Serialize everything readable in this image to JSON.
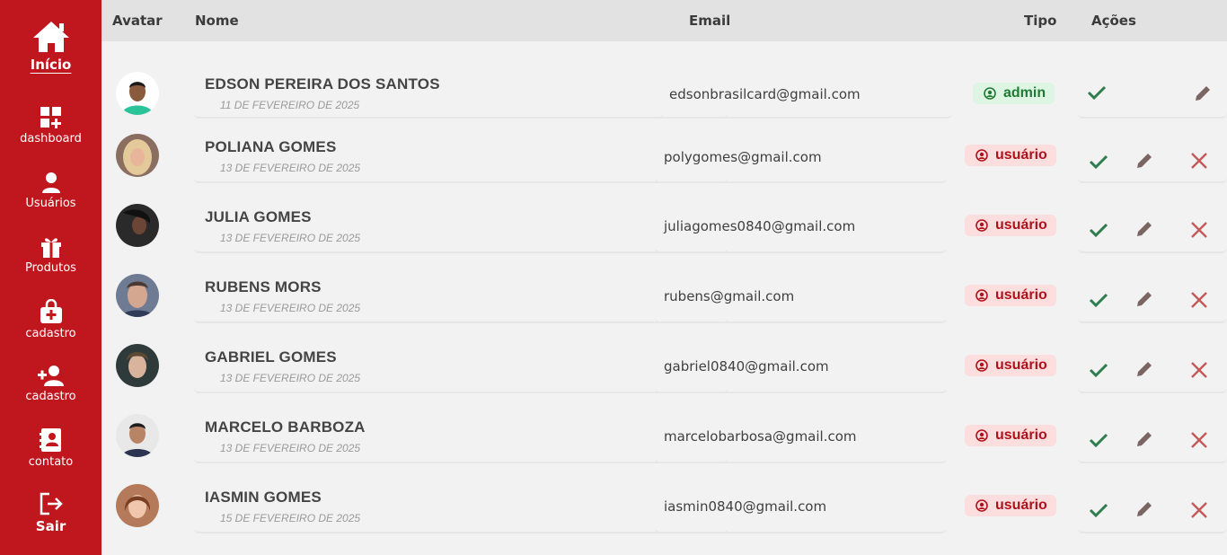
{
  "sidebar": {
    "items": [
      {
        "label": "Início",
        "icon": "home-icon"
      },
      {
        "label": "dashboard",
        "icon": "dashboard-icon"
      },
      {
        "label": "Usuários",
        "icon": "user-icon"
      },
      {
        "label": "Produtos",
        "icon": "gift-icon"
      },
      {
        "label": "cadastro",
        "icon": "bag-plus-icon"
      },
      {
        "label": "cadastro",
        "icon": "person-add-icon"
      },
      {
        "label": "contato",
        "icon": "contact-book-icon"
      },
      {
        "label": "Sair",
        "icon": "logout-icon"
      }
    ]
  },
  "table": {
    "headers": {
      "avatar": "Avatar",
      "nome": "Nome",
      "email": "Email",
      "tipo": "Tipo",
      "acoes": "Ações"
    },
    "rows": [
      {
        "name": "EDSON PEREIRA DOS SANTOS",
        "date": "11 DE FEVEREIRO DE 2025",
        "email": "edsonbrasilcard@gmail.com",
        "tipo": "admin"
      },
      {
        "name": "POLIANA GOMES",
        "date": "13 DE FEVEREIRO DE 2025",
        "email": "polygomes@gmail.com",
        "tipo": "usuário"
      },
      {
        "name": "JULIA GOMES",
        "date": "13 DE FEVEREIRO DE 2025",
        "email": "juliagomes0840@gmail.com",
        "tipo": "usuário"
      },
      {
        "name": "RUBENS MORS",
        "date": "13 DE FEVEREIRO DE 2025",
        "email": "rubens@gmail.com",
        "tipo": "usuário"
      },
      {
        "name": "GABRIEL GOMES",
        "date": "13 DE FEVEREIRO DE 2025",
        "email": "gabriel0840@gmail.com",
        "tipo": "usuário"
      },
      {
        "name": "MARCELO BARBOZA",
        "date": "13 DE FEVEREIRO DE 2025",
        "email": "marcelobarbosa@gmail.com",
        "tipo": "usuário"
      },
      {
        "name": "IASMIN GOMES",
        "date": "15 DE FEVEREIRO DE 2025",
        "email": "iasmin0840@gmail.com",
        "tipo": "usuário"
      }
    ]
  },
  "colors": {
    "sidebar": "#c0171e",
    "admin_badge": "#ddf5e2",
    "user_badge": "#fcdede",
    "approve": "#2e7d4f",
    "edit": "#7a6563",
    "delete": "#c25a5a"
  }
}
